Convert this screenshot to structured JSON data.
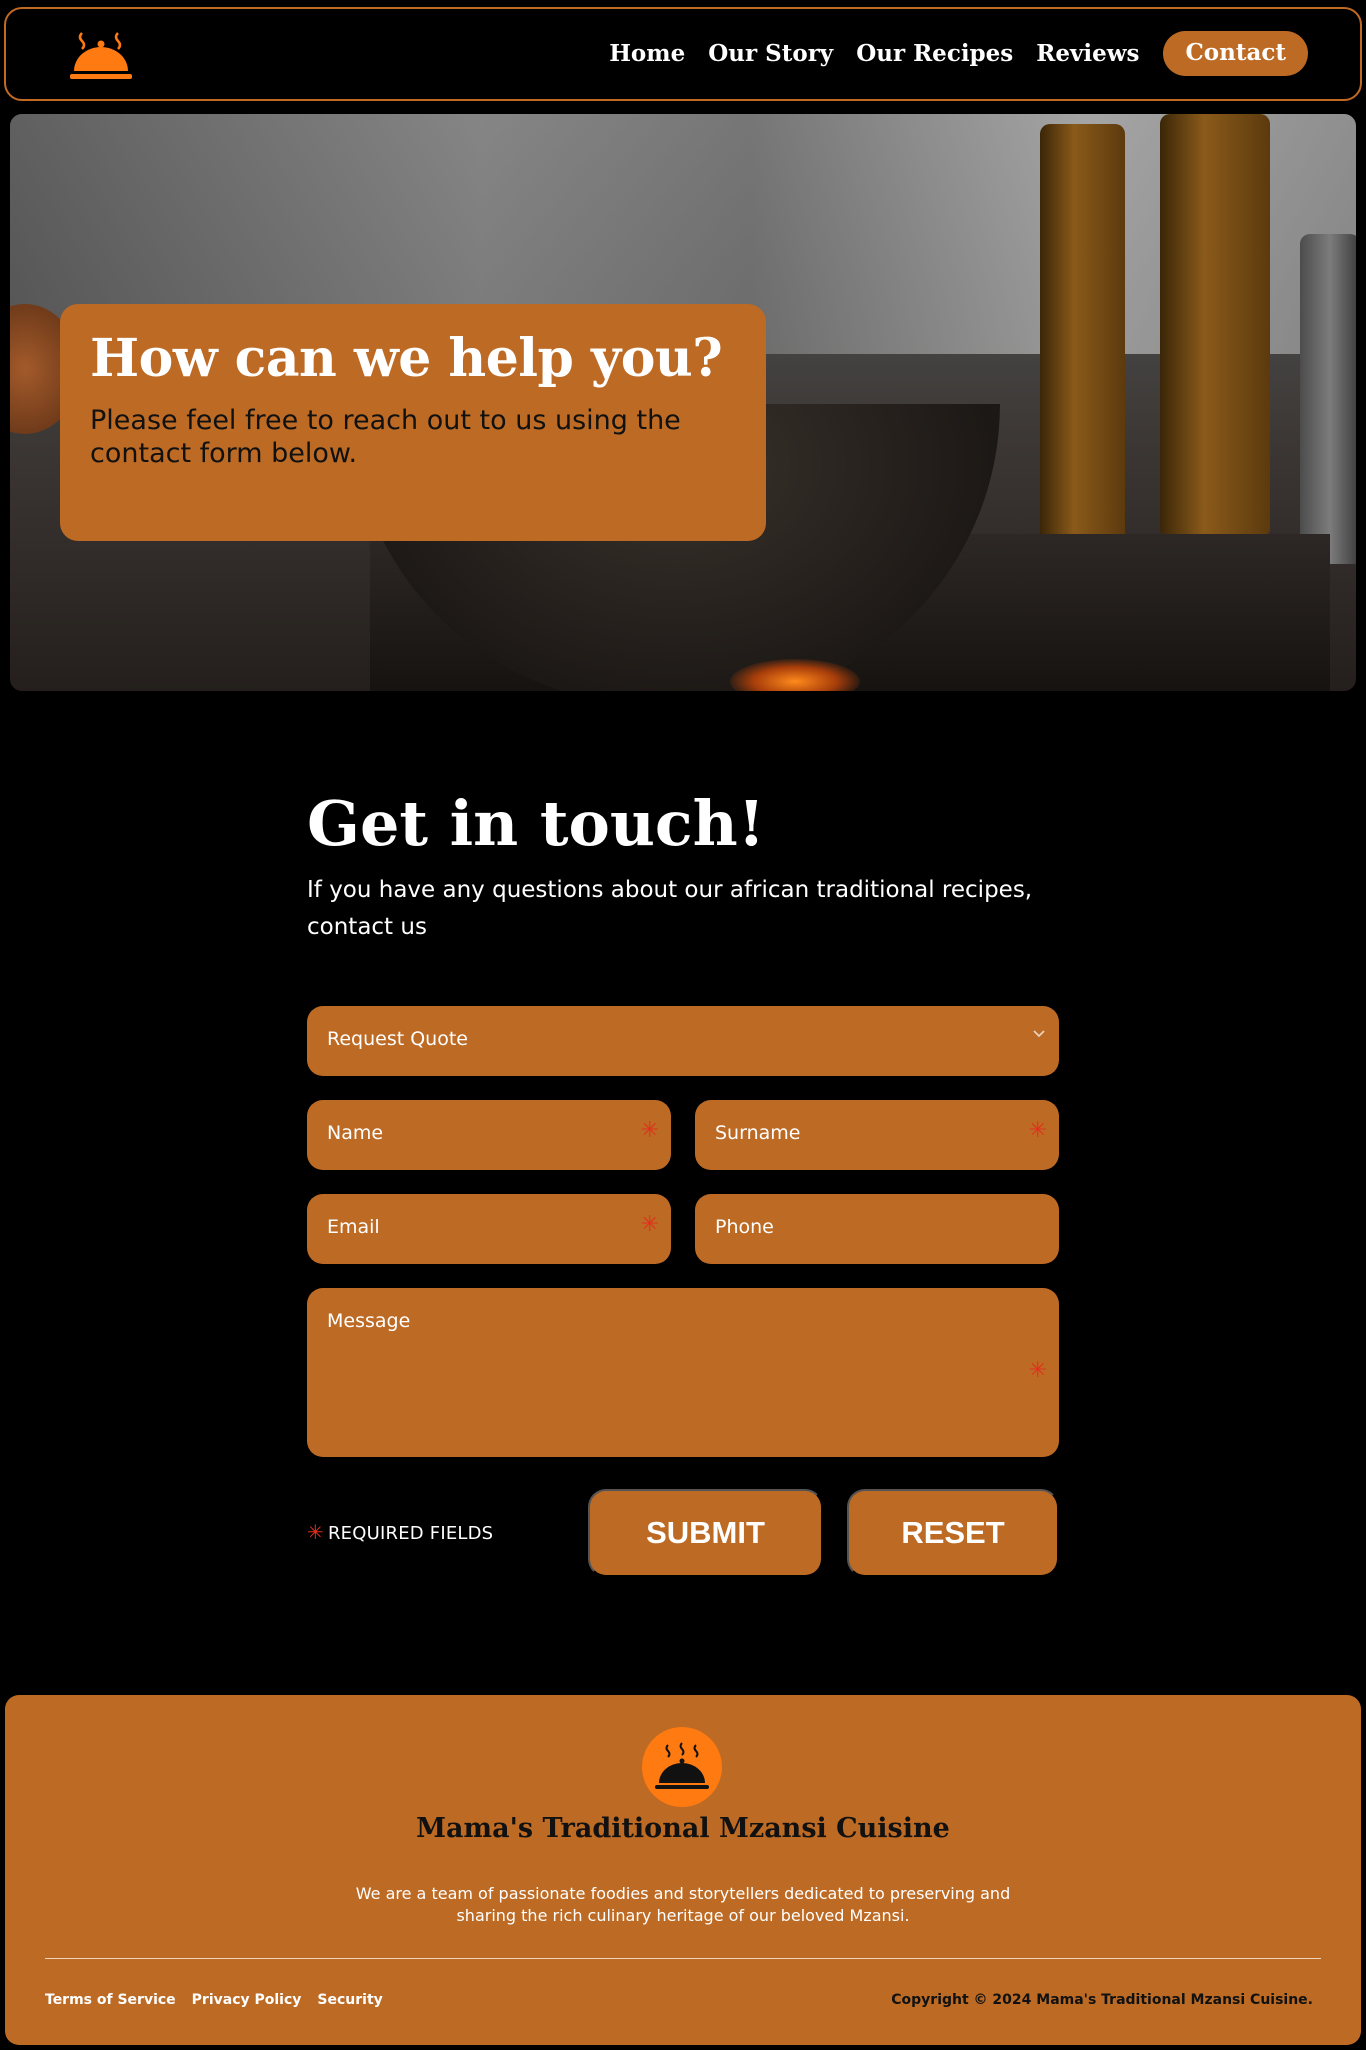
{
  "nav": {
    "logo_icon": "cloche-icon",
    "links": [
      "Home",
      "Our Story",
      "Our Recipes",
      "Reviews"
    ],
    "contact": "Contact"
  },
  "hero": {
    "title": "How can we help you?",
    "subtitle": "Please feel free to reach out to us using the contact form below."
  },
  "contact": {
    "title": "Get in touch!",
    "subtitle": "If you have any questions about our african traditional recipes, contact us",
    "fields": {
      "request": "Request Quote",
      "name": "Name",
      "surname": "Surname",
      "email": "Email",
      "phone": "Phone",
      "message": "Message"
    },
    "required_note": "REQUIRED FIELDS",
    "submit": "SUBMIT",
    "reset": "RESET"
  },
  "footer": {
    "brand": "Mama's Traditional Mzansi Cuisine",
    "description": "We are a team of passionate foodies and storytellers dedicated to preserving and sharing the rich culinary heritage of our beloved Mzansi.",
    "links": [
      "Terms of Service",
      "Privacy Policy",
      "Security"
    ],
    "copyright": "Copyright © 2024 Mama's Traditional Mzansi Cuisine."
  },
  "colors": {
    "accent": "#bd6a24",
    "logo_orange": "#ff7a10",
    "required": "#e0301e",
    "background": "#000000"
  }
}
